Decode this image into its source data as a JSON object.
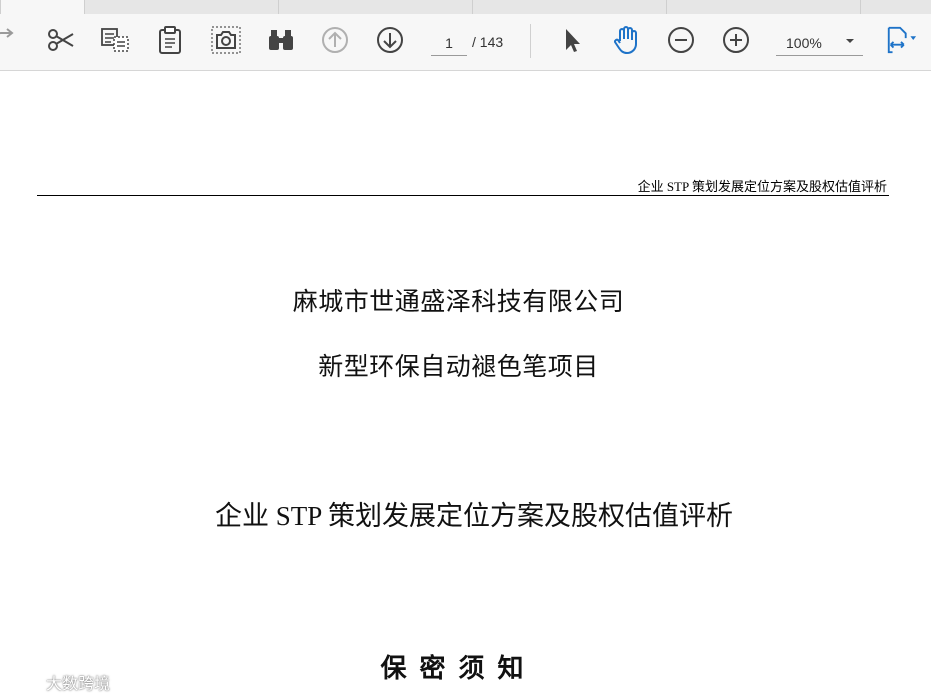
{
  "toolbar": {
    "icons": [
      "redo-icon",
      "scissors-icon",
      "copy-icon",
      "clipboard-icon",
      "snapshot-camera-icon",
      "find-binoculars-icon",
      "page-up-icon",
      "page-down-icon",
      "select-cursor-icon",
      "hand-tool-icon",
      "zoom-out-icon",
      "zoom-in-icon",
      "fit-page-icon"
    ],
    "page_current": "1",
    "page_total": "/ 143",
    "zoom_value": "100%"
  },
  "colors": {
    "accent": "#1e73c8",
    "icon": "#444444",
    "disabled": "#b0b0b0"
  },
  "document": {
    "running_header": "企业 STP 策划发展定位方案及股权估值评析",
    "company": "麻城市世通盛泽科技有限公司",
    "project": "新型环保自动褪色笔项目",
    "report_title": "企业 STP 策划发展定位方案及股权估值评析",
    "notice_heading": "保密须知"
  },
  "watermark": {
    "text": "大数跨境"
  }
}
